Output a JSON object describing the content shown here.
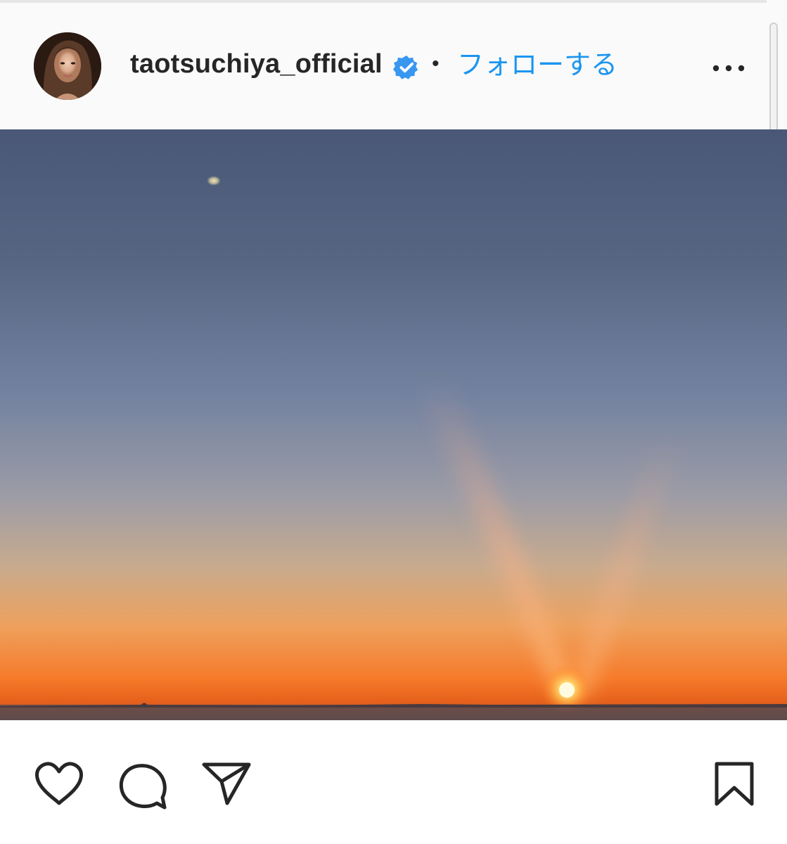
{
  "post": {
    "author": {
      "username": "taotsuchiya_official",
      "verified": true,
      "avatar_icon": "profile-photo-avatar"
    },
    "separator": "•",
    "follow_label": "フォローする",
    "more_icon": "ellipsis-icon",
    "photo_description": "sunset-over-horizon",
    "actions": {
      "like_icon": "heart-icon",
      "comment_icon": "comment-bubble-icon",
      "share_icon": "paper-plane-icon",
      "save_icon": "bookmark-icon"
    }
  },
  "colors": {
    "follow": "#1b95f0",
    "verified_badge": "#3897f0",
    "text": "#262626",
    "sky_top": "#4a5a7a",
    "horizon_orange": "#f26a1e"
  }
}
